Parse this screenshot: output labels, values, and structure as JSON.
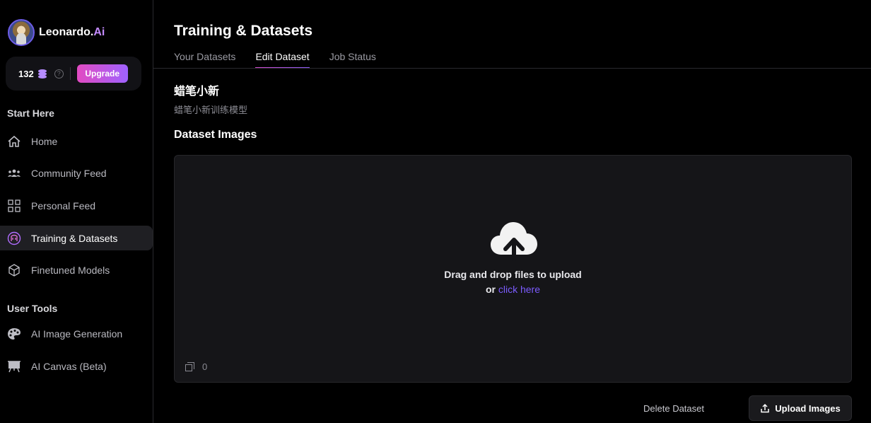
{
  "brand": {
    "name": "Leonardo.",
    "suffix": "Ai"
  },
  "credits": {
    "count": "132",
    "upgrade_label": "Upgrade",
    "help": "?"
  },
  "sidebar": {
    "start_title": "Start Here",
    "user_tools_title": "User Tools",
    "items": [
      {
        "label": "Home",
        "icon": "home-icon"
      },
      {
        "label": "Community Feed",
        "icon": "community-icon"
      },
      {
        "label": "Personal Feed",
        "icon": "grid-icon"
      },
      {
        "label": "Training & Datasets",
        "icon": "training-icon",
        "active": true
      },
      {
        "label": "Finetuned Models",
        "icon": "cube-icon"
      },
      {
        "label": "AI Image Generation",
        "icon": "palette-icon"
      },
      {
        "label": "AI Canvas (Beta)",
        "icon": "easel-icon"
      }
    ]
  },
  "main": {
    "title": "Training & Datasets",
    "tabs": [
      {
        "label": "Your Datasets"
      },
      {
        "label": "Edit Dataset",
        "active": true
      },
      {
        "label": "Job Status"
      }
    ],
    "dataset_name": "蜡笔小新",
    "dataset_description": "蜡笔小新训练模型",
    "images_title": "Dataset Images",
    "dropzone": {
      "main_text": "Drag and drop files to upload",
      "or_text": "or",
      "link_text": "click here",
      "image_count": "0"
    },
    "delete_label": "Delete Dataset",
    "upload_label": "Upload Images"
  },
  "colors": {
    "accent": "#7c5cff",
    "gradient_start": "#e24bc2",
    "gradient_end": "#9f62ff"
  }
}
